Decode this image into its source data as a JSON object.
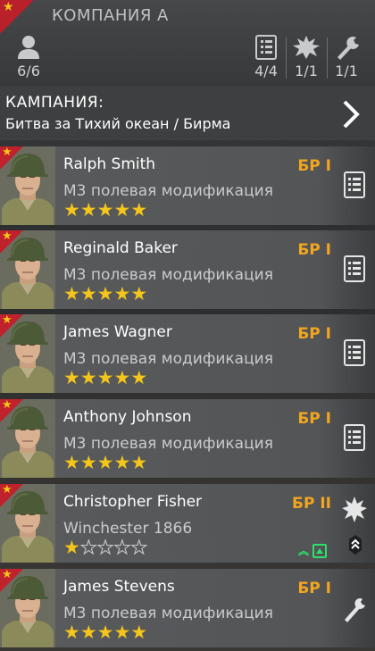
{
  "squad": {
    "name": "КОМПАНИЯ А",
    "soldiers_count": "6/6",
    "stats": [
      {
        "icon": "clipboard-icon",
        "value": "4/4"
      },
      {
        "icon": "explosion-icon",
        "value": "1/1"
      },
      {
        "icon": "wrench-icon",
        "value": "1/1"
      }
    ]
  },
  "campaign": {
    "label": "КАМПАНИЯ:",
    "name": "Битва за Тихий океан / Бирма"
  },
  "soldiers": [
    {
      "name": "Ralph Smith",
      "weapon": "M3 полевая модификация",
      "stars": 5,
      "rank": "БР I",
      "role_icon": "clipboard-icon"
    },
    {
      "name": "Reginald Baker",
      "weapon": "M3 полевая модификация",
      "stars": 5,
      "rank": "БР I",
      "role_icon": "clipboard-icon"
    },
    {
      "name": "James Wagner",
      "weapon": "M3 полевая модификация",
      "stars": 5,
      "rank": "БР I",
      "role_icon": "clipboard-icon"
    },
    {
      "name": "Anthony Johnson",
      "weapon": "M3 полевая модификация",
      "stars": 5,
      "rank": "БР I",
      "role_icon": "clipboard-icon"
    },
    {
      "name": "Christopher Fisher",
      "weapon": "Winchester 1866",
      "stars": 1,
      "rank": "БР II",
      "role_icon": "explosion-icon",
      "upgrade_available": true
    },
    {
      "name": "James Stevens",
      "weapon": "M3 полевая модификация",
      "stars": 5,
      "rank": "БР I",
      "role_icon": "wrench-icon"
    }
  ],
  "colors": {
    "accent_red": "#c0222c",
    "star_gold": "#f4c51a",
    "rank_orange": "#f2a51f",
    "upgrade_green": "#2ee06a"
  }
}
